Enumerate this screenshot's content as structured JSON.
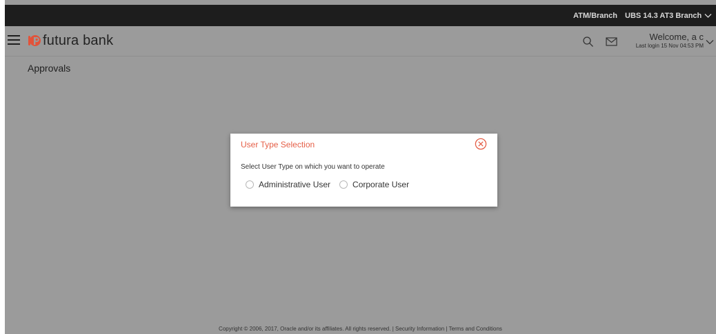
{
  "topbar": {
    "atm_label": "ATM/Branch",
    "branch_label": "UBS 14.3 AT3 Branch"
  },
  "header": {
    "logo_text": "futura bank",
    "welcome": "Welcome, a c",
    "last_login": "Last login 15 Nov 04:53 PM"
  },
  "page": {
    "title": "Approvals"
  },
  "modal": {
    "title": "User Type Selection",
    "prompt": "Select User Type on which you want to operate",
    "options": [
      {
        "label": "Administrative User"
      },
      {
        "label": "Corporate User"
      }
    ]
  },
  "footer": {
    "copyright": "Copyright © 2006, 2017, Oracle and/or its affiliates. All rights reserved.",
    "separator": "|",
    "security_link": "Security Information",
    "terms_link": "Terms and Conditions"
  },
  "colors": {
    "overlay_grey": "#9b9b9b",
    "topbar": "#1d1d1d",
    "brand_accent": "#e55e46"
  },
  "icons": {
    "menu": "hamburger-icon",
    "logo": "futura-logo-icon",
    "search": "search-icon",
    "mail": "mail-icon",
    "chevron": "chevron-down-icon",
    "close": "close-circle-icon"
  }
}
